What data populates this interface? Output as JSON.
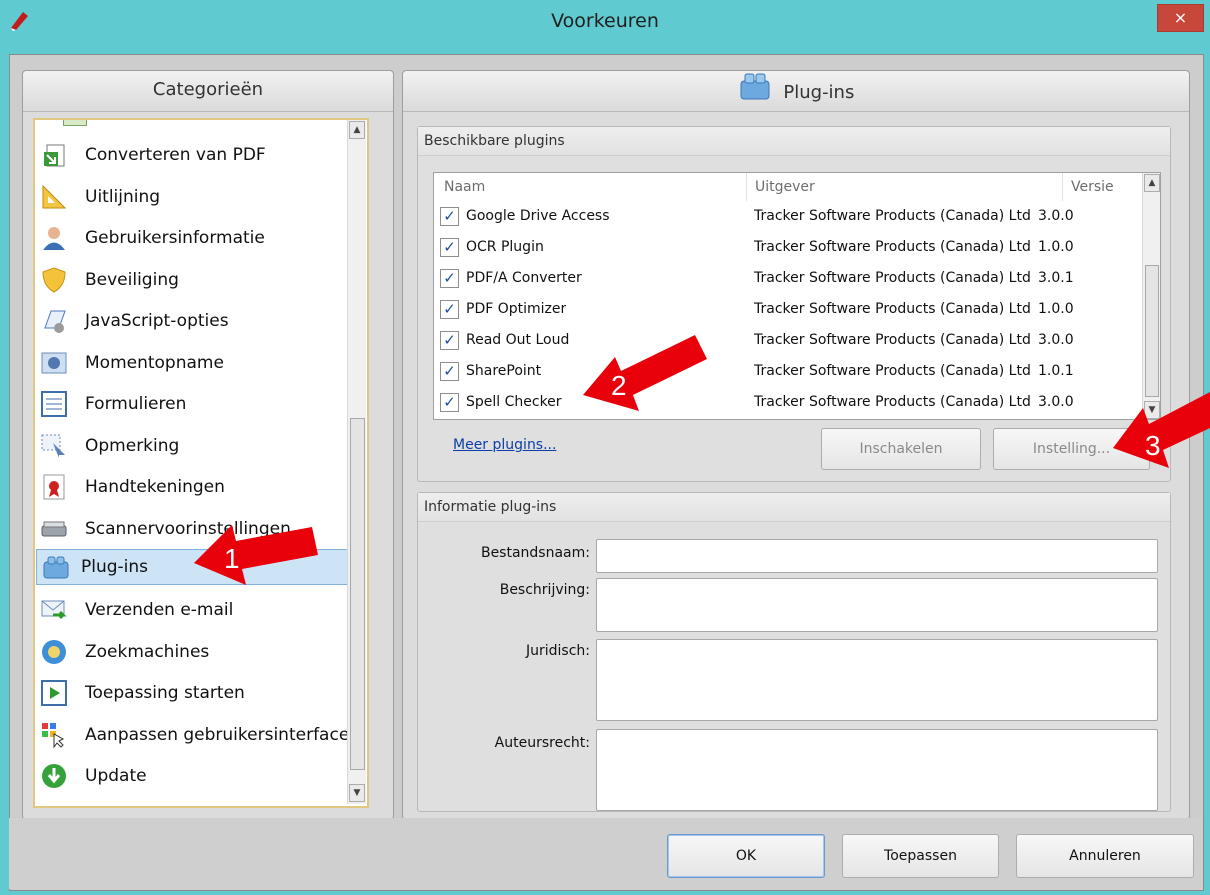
{
  "window": {
    "title": "Voorkeuren",
    "close_glyph": "×"
  },
  "categories": {
    "header": "Categorieën",
    "items": [
      {
        "label": "Converteren van PDF",
        "icon": "convert-pdf-icon"
      },
      {
        "label": "Uitlijning",
        "icon": "ruler-icon"
      },
      {
        "label": "Gebruikersinformatie",
        "icon": "user-icon"
      },
      {
        "label": "Beveiliging",
        "icon": "shield-icon"
      },
      {
        "label": "JavaScript-opties",
        "icon": "javascript-icon"
      },
      {
        "label": "Momentopname",
        "icon": "camera-icon"
      },
      {
        "label": "Formulieren",
        "icon": "form-icon"
      },
      {
        "label": "Opmerking",
        "icon": "comment-icon"
      },
      {
        "label": "Handtekeningen",
        "icon": "signature-icon"
      },
      {
        "label": "Scannervoorinstellingen",
        "icon": "scanner-icon"
      },
      {
        "label": "Plug-ins",
        "icon": "plugin-icon",
        "selected": true
      },
      {
        "label": "Verzenden e-mail",
        "icon": "email-icon"
      },
      {
        "label": "Zoekmachines",
        "icon": "search-engine-icon"
      },
      {
        "label": "Toepassing starten",
        "icon": "play-icon"
      },
      {
        "label": "Aanpassen gebruikersinterface",
        "icon": "customize-ui-icon"
      },
      {
        "label": "Update",
        "icon": "update-icon"
      }
    ]
  },
  "plugins_panel": {
    "header": "Plug-ins",
    "available": {
      "title": "Beschikbare plugins",
      "columns": {
        "name": "Naam",
        "publisher": "Uitgever",
        "version": "Versie"
      },
      "rows": [
        {
          "name": "Google Drive Access",
          "publisher": "Tracker Software Products (Canada) Ltd",
          "version": "3.0.0",
          "checked": true
        },
        {
          "name": "OCR Plugin",
          "publisher": "Tracker Software Products (Canada) Ltd",
          "version": "1.0.0",
          "checked": true
        },
        {
          "name": "PDF/A Converter",
          "publisher": "Tracker Software Products (Canada) Ltd",
          "version": "3.0.1",
          "checked": true
        },
        {
          "name": "PDF Optimizer",
          "publisher": "Tracker Software Products (Canada) Ltd",
          "version": "1.0.0",
          "checked": true
        },
        {
          "name": "Read Out Loud",
          "publisher": "Tracker Software Products (Canada) Ltd",
          "version": "3.0.0",
          "checked": true
        },
        {
          "name": "SharePoint",
          "publisher": "Tracker Software Products (Canada) Ltd",
          "version": "1.0.1",
          "checked": true
        },
        {
          "name": "Spell Checker",
          "publisher": "Tracker Software Products (Canada) Ltd",
          "version": "3.0.0",
          "checked": true
        }
      ],
      "more_link": "Meer plugins...",
      "enable_button": "Inschakelen",
      "settings_button": "Instelling..."
    },
    "info": {
      "title": "Informatie plug-ins",
      "filename_label": "Bestandsnaam:",
      "description_label": "Beschrijving:",
      "legal_label": "Juridisch:",
      "copyright_label": "Auteursrecht:"
    }
  },
  "footer": {
    "ok": "OK",
    "apply": "Toepassen",
    "cancel": "Annuleren"
  },
  "annotations": {
    "arrow1": "1",
    "arrow2": "2",
    "arrow3": "3",
    "arrow_color": "#e8000b"
  }
}
